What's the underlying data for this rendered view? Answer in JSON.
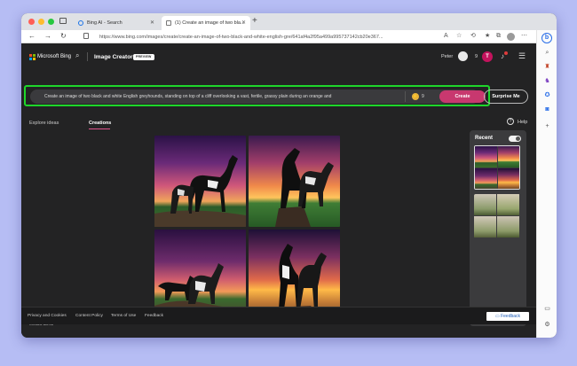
{
  "browser": {
    "tabs": [
      {
        "label": "Bing AI - Search"
      },
      {
        "label": "(1) Create an image of two bla..."
      }
    ],
    "new_tab": "+",
    "url": "https://www.bing.com/images/create/create-an-image-of-two-black-and-white-english-gre/641af4a2f95a499a995737142cb20e367..."
  },
  "header": {
    "brand": "Microsoft Bing",
    "product": "Image Creator",
    "badge": "PREVIEW",
    "user": "Peter",
    "coins": "9",
    "reward_letter": "T"
  },
  "prompt": {
    "text": "Create an image of two black and white English greyhounds, standing on top of a cliff overlooking a vast, fertile, grassy plain during an orange and",
    "boosts": "9",
    "create_label": "Create",
    "surprise_label": "Surprise Me"
  },
  "tabs": {
    "explore": "Explore ideas",
    "creations": "Creations",
    "help": "Help"
  },
  "recent": {
    "label": "Recent"
  },
  "created_with": "Created with AI",
  "footer": {
    "links": [
      "Privacy and Cookies",
      "Content Policy",
      "Terms of Use",
      "Feedback"
    ],
    "feedback_button": "Feedback"
  },
  "colors": {
    "highlight": "#1ed62b",
    "create_button": "#c8386f",
    "accent_underline": "#e0558e"
  }
}
